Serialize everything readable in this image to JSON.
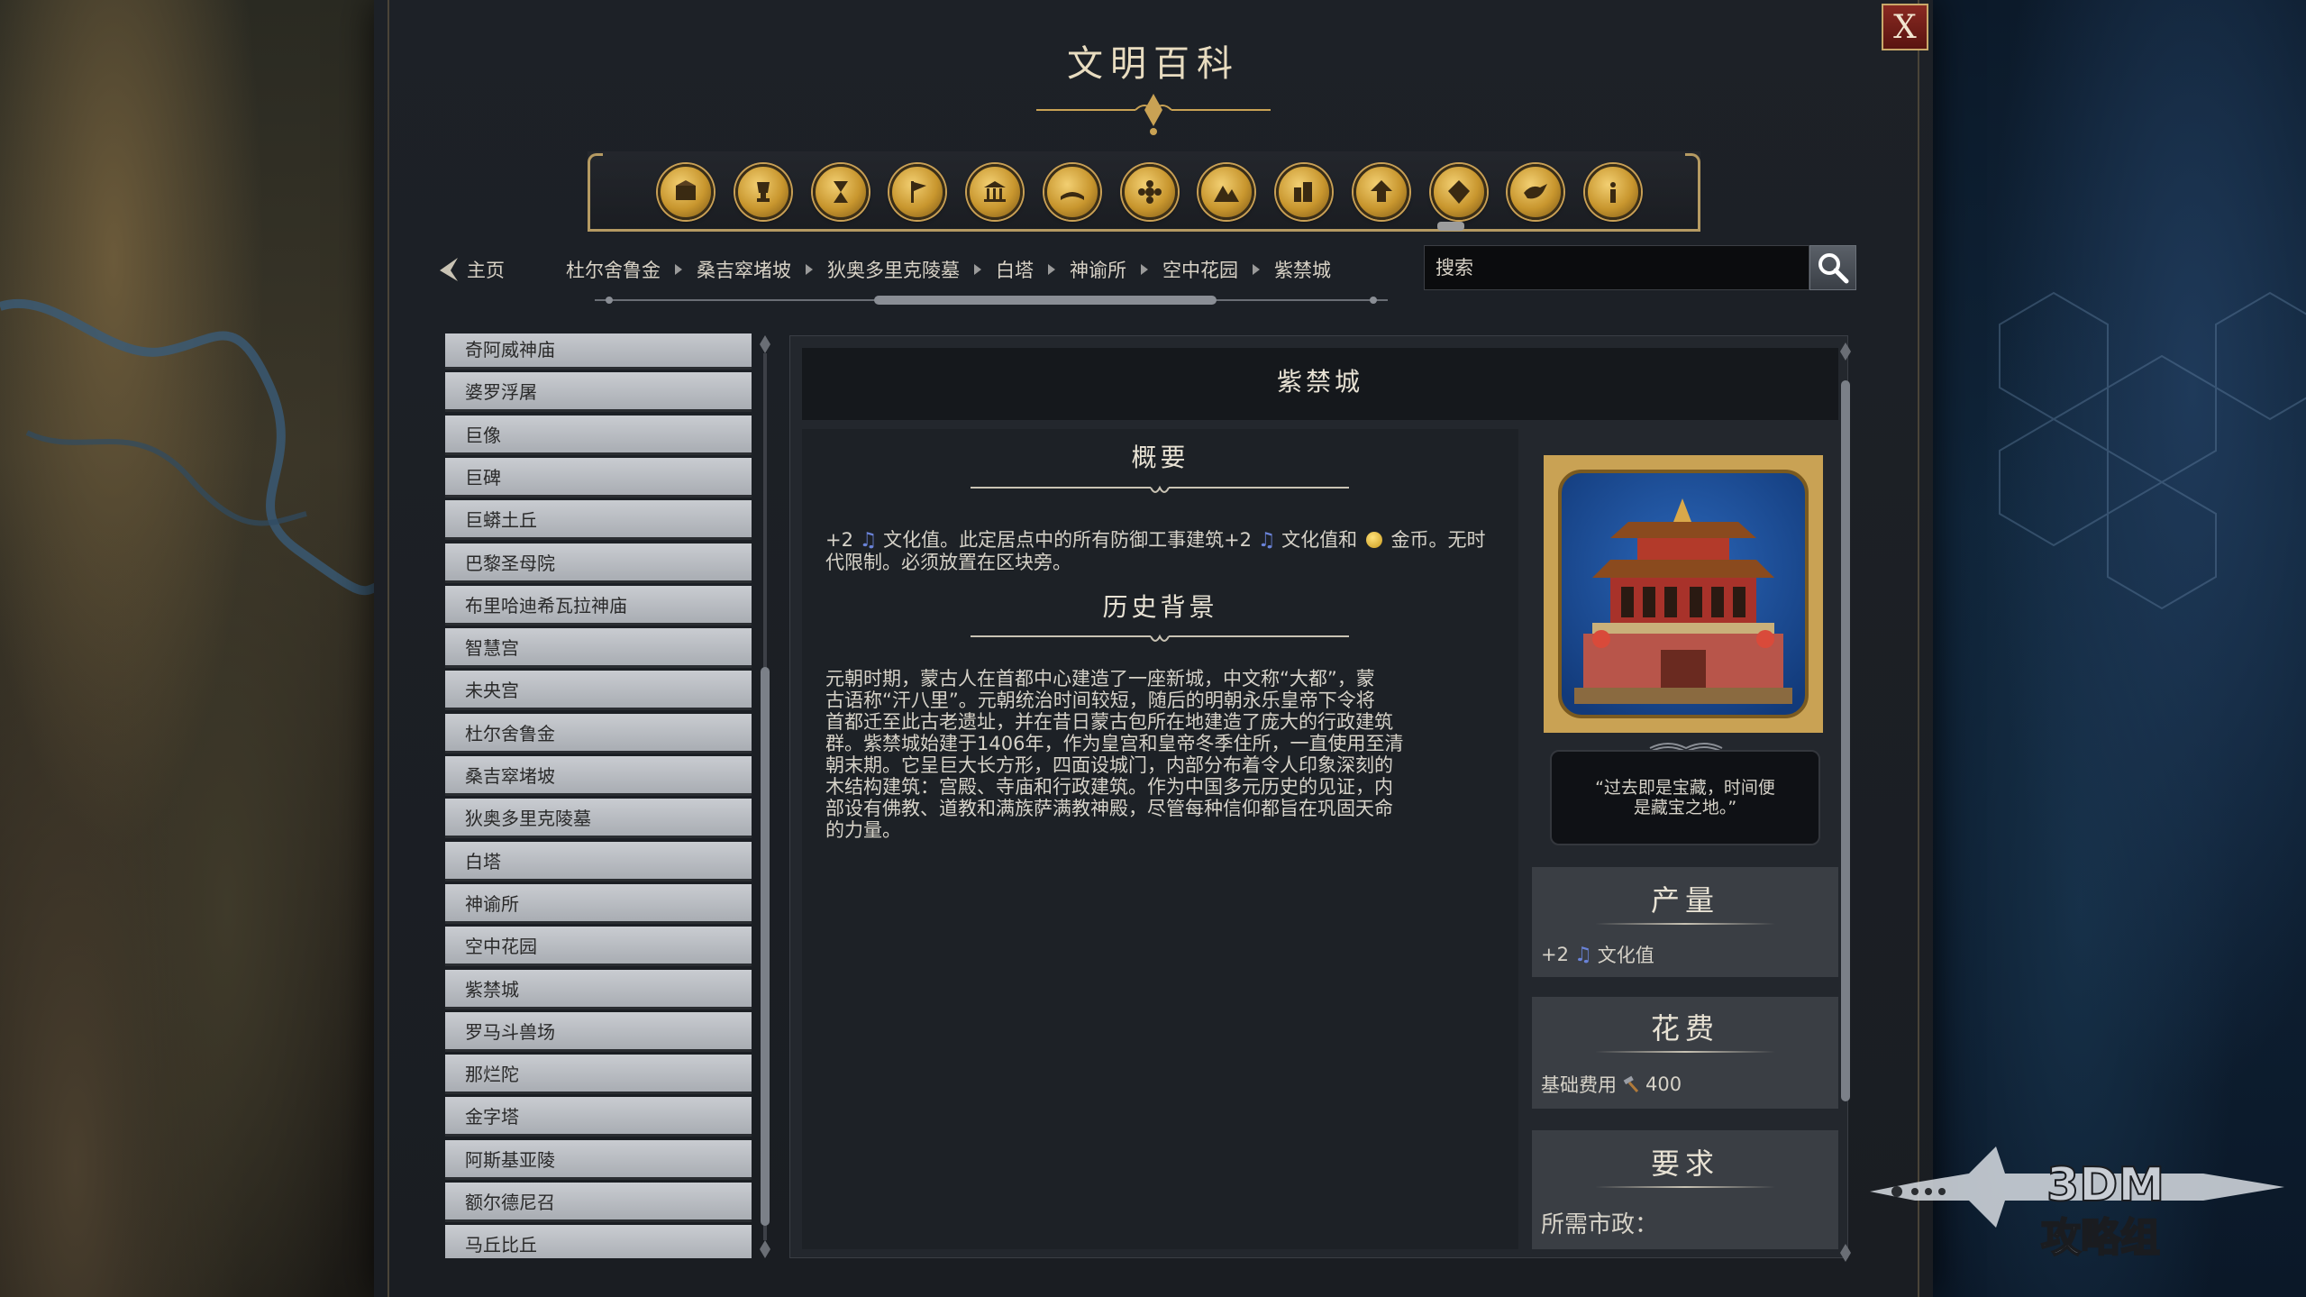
{
  "window": {
    "title": "文明百科",
    "close_label": "X"
  },
  "categories": [
    {
      "icon": "resources-icon"
    },
    {
      "icon": "trophy-icon"
    },
    {
      "icon": "hourglass-icon"
    },
    {
      "icon": "flag-icon"
    },
    {
      "icon": "temple-icon"
    },
    {
      "icon": "book-icon"
    },
    {
      "icon": "flower-icon"
    },
    {
      "icon": "mountains-icon"
    },
    {
      "icon": "city-icon"
    },
    {
      "icon": "upgrade-arrow-icon"
    },
    {
      "icon": "diamond-icon"
    },
    {
      "icon": "dove-icon"
    },
    {
      "icon": "info-icon"
    }
  ],
  "nav": {
    "home_label": "主页",
    "breadcrumb": [
      "杜尔舍鲁金",
      "桑吉窣堵坡",
      "狄奥多里克陵墓",
      "白塔",
      "神谕所",
      "空中花园",
      "紫禁城"
    ],
    "search_placeholder": "搜索"
  },
  "list": {
    "items": [
      "奇阿威神庙",
      "婆罗浮屠",
      "巨像",
      "巨碑",
      "巨蟒土丘",
      "巴黎圣母院",
      "布里哈迪希瓦拉神庙",
      "智慧宫",
      "未央宫",
      "杜尔舍鲁金",
      "桑吉窣堵坡",
      "狄奥多里克陵墓",
      "白塔",
      "神谕所",
      "空中花园",
      "紫禁城",
      "罗马斗兽场",
      "那烂陀",
      "金字塔",
      "阿斯基亚陵",
      "额尔德尼召",
      "马丘比丘"
    ]
  },
  "detail": {
    "title": "紫禁城",
    "overview_heading": "概要",
    "overview_p1": "+2",
    "overview_p2": "文化值。此定居点中的所有防御工事建筑+2",
    "overview_p3": "文化值和",
    "overview_p4": "金",
    "overview_p5": "币。无时代限制。必须放置在区块旁。",
    "history_heading": "历史背景",
    "history_lines": [
      "元朝时期，蒙古人在首都中心建造了一座新城，中文称“大都”，蒙",
      "古语称“汗八里”。元朝统治时间较短，随后的明朝永乐皇帝下令将",
      "首都迁至此古老遗址，并在昔日蒙古包所在地建造了庞大的行政建筑",
      "群。紫禁城始建于1406年，作为皇宫和皇帝冬季住所，一直使用至清",
      "朝末期。它呈巨大长方形，四面设城门，内部分布着令人印象深刻的",
      "木结构建筑：宫殿、寺庙和行政建筑。作为中国多元历史的见证，内",
      "部设有佛教、道教和满族萨满教神殿，尽管每种信仰都旨在巩固天命",
      "的力量。"
    ],
    "quote_line1": "“过去即是宝藏，时间便",
    "quote_line2": "是藏宝之地。”",
    "production_heading": "产量",
    "production_value": "+2",
    "production_label": "文化值",
    "cost_heading": "花费",
    "cost_label": "基础费用",
    "cost_value": "400",
    "requirement_heading": "要求",
    "requirement_label": "所需市政："
  },
  "watermark": {
    "line1": "3DM",
    "line2": "攻略组"
  },
  "colors": {
    "accent_gold": "#c9a254",
    "culture_blue": "#6a83d8",
    "close_red": "#8a2a22"
  }
}
